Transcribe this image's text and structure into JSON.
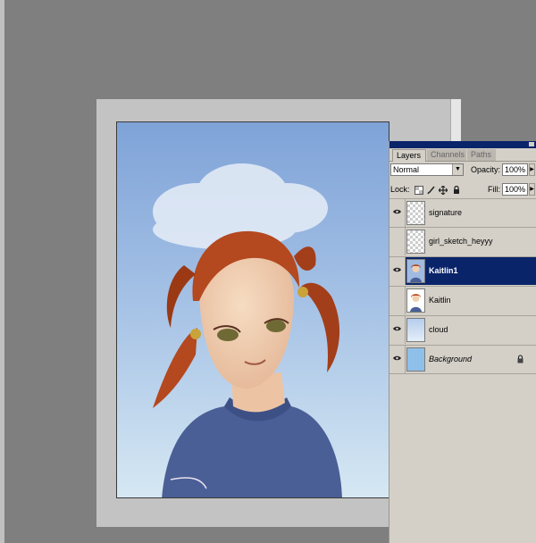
{
  "layers_panel": {
    "tabs": [
      {
        "label": "Layers",
        "active": true
      },
      {
        "label": "Channels",
        "active": false
      },
      {
        "label": "Paths",
        "active": false
      }
    ],
    "blend_mode": "Normal",
    "opacity_label": "Opacity:",
    "opacity_value": "100%",
    "lock_label": "Lock:",
    "fill_label": "Fill:",
    "fill_value": "100%",
    "layers": [
      {
        "name": "signature",
        "visible": true,
        "thumbnail": "transparent"
      },
      {
        "name": "girl_sketch_heyyy",
        "visible": false,
        "thumbnail": "transparent"
      },
      {
        "name": "Kaitlin1",
        "visible": true,
        "thumbnail": "girl",
        "selected": true
      },
      {
        "name": "Kaitlin",
        "visible": false,
        "thumbnail": "girl"
      },
      {
        "name": "cloud",
        "visible": true,
        "thumbnail": "cloud"
      },
      {
        "name": "Background",
        "visible": true,
        "thumbnail": "sky",
        "locked": true
      }
    ]
  },
  "colors": {
    "workspace": "#7f7f7f",
    "selection": "#0a246a",
    "panel": "#d4d0c8",
    "sky": "#8fb0de",
    "hair": "#b4481f",
    "sweater": "#4a5f96"
  },
  "icons": [
    "eye-icon",
    "lock-icon",
    "brush-icon",
    "move-icon",
    "checker-icon"
  ]
}
